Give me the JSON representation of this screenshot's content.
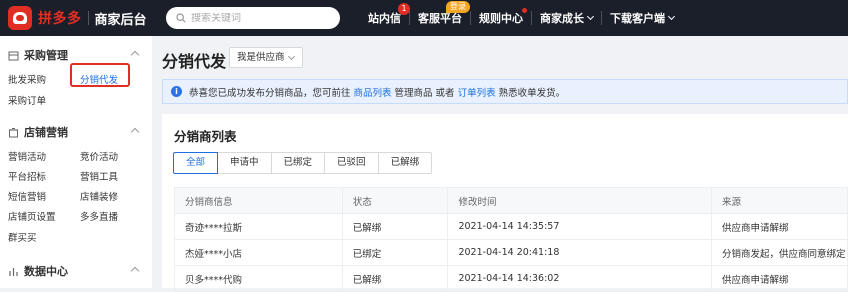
{
  "header": {
    "brand": "拼多多",
    "subtitle": "商家后台",
    "search": {
      "placeholder": "搜索关键词"
    },
    "nav": [
      {
        "label": "站内信",
        "badge": "1"
      },
      {
        "label": "客服平台",
        "tag": "登录"
      },
      {
        "label": "规则中心",
        "dot": true
      },
      {
        "label": "商家成长",
        "dropdown": true
      },
      {
        "label": "下载客户端",
        "dropdown": true
      }
    ]
  },
  "sidebar": {
    "sections": [
      {
        "title": "采购管理",
        "icon": "box-icon",
        "items": [
          "批发采购",
          "分销代发",
          "采购订单"
        ]
      },
      {
        "title": "店铺营销",
        "icon": "store-icon",
        "items": [
          "营销活动",
          "竞价活动",
          "平台招标",
          "营销工具",
          "短信营销",
          "店铺装修",
          "店铺页设置",
          "多多直播",
          "群买买"
        ]
      },
      {
        "title": "数据中心",
        "icon": "bar-chart-icon",
        "items": []
      }
    ],
    "active_item": "分销代发"
  },
  "main": {
    "title": "分销代发",
    "role_select": "我是供应商",
    "notice": {
      "prefix": "恭喜您已成功发布分销商品，您可前往",
      "link1": "商品列表",
      "mid": "管理商品 或者",
      "link2": "订单列表",
      "suffix": "熟悉收单发货。"
    },
    "list": {
      "title": "分销商列表",
      "tabs": [
        "全部",
        "申请中",
        "已绑定",
        "已驳回",
        "已解绑"
      ],
      "active_tab": 0,
      "columns": [
        "分销商信息",
        "状态",
        "修改时间",
        "来源"
      ],
      "rows": [
        [
          "奇迹****拉斯",
          "已解绑",
          "2021-04-14 14:35:57",
          "供应商申请解绑"
        ],
        [
          "杰娅****小店",
          "已绑定",
          "2021-04-14 20:41:18",
          "分销商发起，供应商同意绑定"
        ],
        [
          "贝多****代购",
          "已解绑",
          "2021-04-14 14:36:02",
          "供应商申请解绑"
        ]
      ]
    }
  },
  "colors": {
    "brand_red": "#e02e24",
    "link_blue": "#1f6fe5",
    "topbar_bg": "#1b1f2a"
  }
}
